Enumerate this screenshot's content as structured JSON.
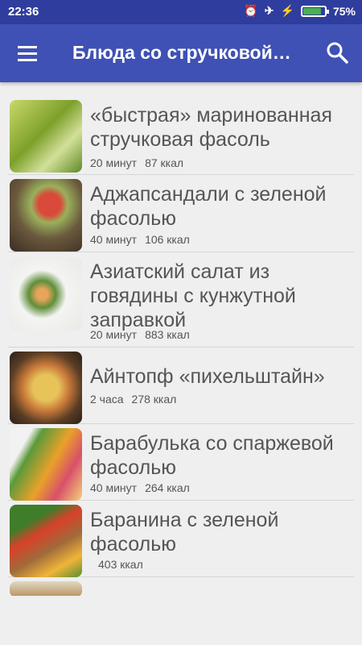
{
  "status": {
    "time": "22:36",
    "battery": "75%",
    "battery_level": 0.75,
    "icons": [
      "alarm-icon",
      "airplane-icon",
      "charging-icon",
      "battery-icon"
    ]
  },
  "appbar": {
    "title": "Блюда со стручковой…",
    "menu_icon": "hamburger-menu-icon",
    "search_icon": "search-icon"
  },
  "colors": {
    "appbar": "#3f51b5",
    "statusbar": "#2f3e9e",
    "background": "#efefef",
    "text": "#555555"
  },
  "recipes": [
    {
      "title": "«быстрая» маринованная стручковая фасоль",
      "time": "20 минут",
      "kcal": "87 ккал"
    },
    {
      "title": "Аджапсандали с зеленой фасолью",
      "time": "40 минут",
      "kcal": "106 ккал"
    },
    {
      "title": "Азиатский салат из говядины с кунжутной заправкой",
      "time": "20 минут",
      "kcal": "883 ккал"
    },
    {
      "title": "Айнтопф «пихельштайн»",
      "time": "2 часа",
      "kcal": "278 ккал"
    },
    {
      "title": "Барабулька со спаржевой фасолью",
      "time": "40 минут",
      "kcal": "264 ккал"
    },
    {
      "title": "Баранина с зеленой фасолью",
      "time": "",
      "kcal": "403 ккал"
    }
  ]
}
